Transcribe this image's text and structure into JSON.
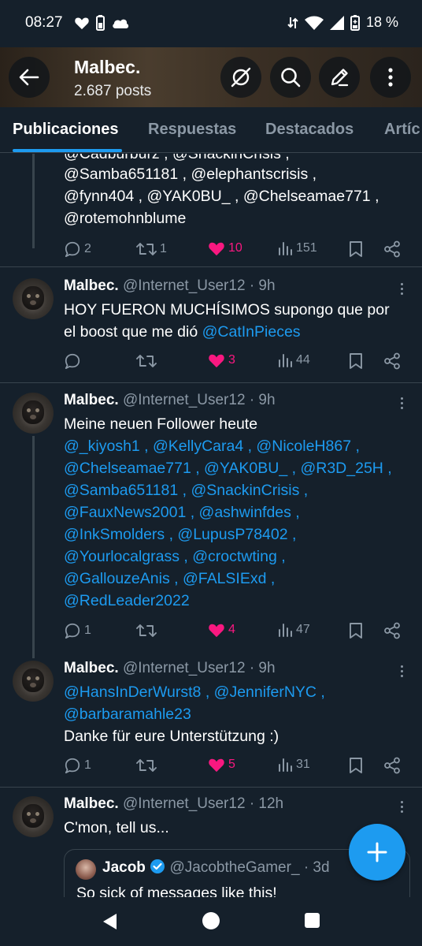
{
  "status_bar": {
    "time": "08:27",
    "battery_percent": "18 %"
  },
  "header": {
    "title": "Malbec.",
    "posts_count": "2.687 posts"
  },
  "tabs": [
    {
      "label": "Publicaciones",
      "active": true
    },
    {
      "label": "Respuestas",
      "active": false
    },
    {
      "label": "Destacados",
      "active": false
    },
    {
      "label": "Artíc",
      "active": false
    }
  ],
  "post0": {
    "lines": [
      "@Cadburburz , @SnackinCrisis ,",
      "@Samba651181 , @elephantscrisis ,",
      "@fynn404 , @YAK0BU_ , @Chelseamae771 ,",
      "@rotemohnblume"
    ],
    "replies": "2",
    "reposts": "1",
    "likes": "10",
    "views": "151"
  },
  "post1": {
    "name": "Malbec.",
    "handle": "@Internet_User12",
    "time": "· 9h",
    "line1": "HOY FUERON MUCHÍSIMOS supongo que por",
    "line2_text": "el boost que me dió ",
    "line2_mention": "@CatInPieces",
    "replies": "",
    "reposts": "",
    "likes": "3",
    "views": "44"
  },
  "post2": {
    "name": "Malbec.",
    "handle": "@Internet_User12",
    "time": "· 9h",
    "line1": "Meine neuen Follower heute",
    "mention_lines": [
      "@_kiyosh1 , @KellyCara4 , @NicoleH867 ,",
      "@Chelseamae771 , @YAK0BU_ , @R3D_25H ,",
      "@Samba651181 , @SnackinCrisis ,",
      "@FauxNews2001 , @ashwinfdes ,",
      "@InkSmolders , @LupusP78402 ,",
      "@Yourlocalgrass , @croctwting ,",
      "@GallouzeAnis , @FALSIExd ,",
      "@RedLeader2022"
    ],
    "replies": "1",
    "reposts": "",
    "likes": "4",
    "views": "47"
  },
  "post3": {
    "name": "Malbec.",
    "handle": "@Internet_User12",
    "time": "· 9h",
    "mention_lines": [
      "@HansInDerWurst8 , @JenniferNYC ,",
      "@barbaramahle23"
    ],
    "line_text": "Danke für eure Unterstützung :)",
    "replies": "1",
    "reposts": "",
    "likes": "5",
    "views": "31"
  },
  "post4": {
    "name": "Malbec.",
    "handle": "@Internet_User12",
    "time": "· 12h",
    "text": "C'mon, tell us...",
    "quote": {
      "name": "Jacob",
      "handle": "@JacobtheGamer_",
      "time": "· 3d",
      "text": "So sick of messages like this!"
    }
  },
  "colors": {
    "background": "#15202b",
    "accent": "#1d9bf0",
    "like": "#f91880",
    "muted": "#8b98a5",
    "divider": "#38444d"
  },
  "icons": [
    "heart-icon",
    "battery-icon",
    "cloud-icon",
    "wifi-icon",
    "signal-icon",
    "back-arrow-icon",
    "no-eye-icon",
    "search-icon",
    "edit-icon",
    "more-vertical-icon",
    "reply-icon",
    "repost-icon",
    "like-icon",
    "views-icon",
    "bookmark-icon",
    "share-icon",
    "verified-icon",
    "plus-icon"
  ]
}
